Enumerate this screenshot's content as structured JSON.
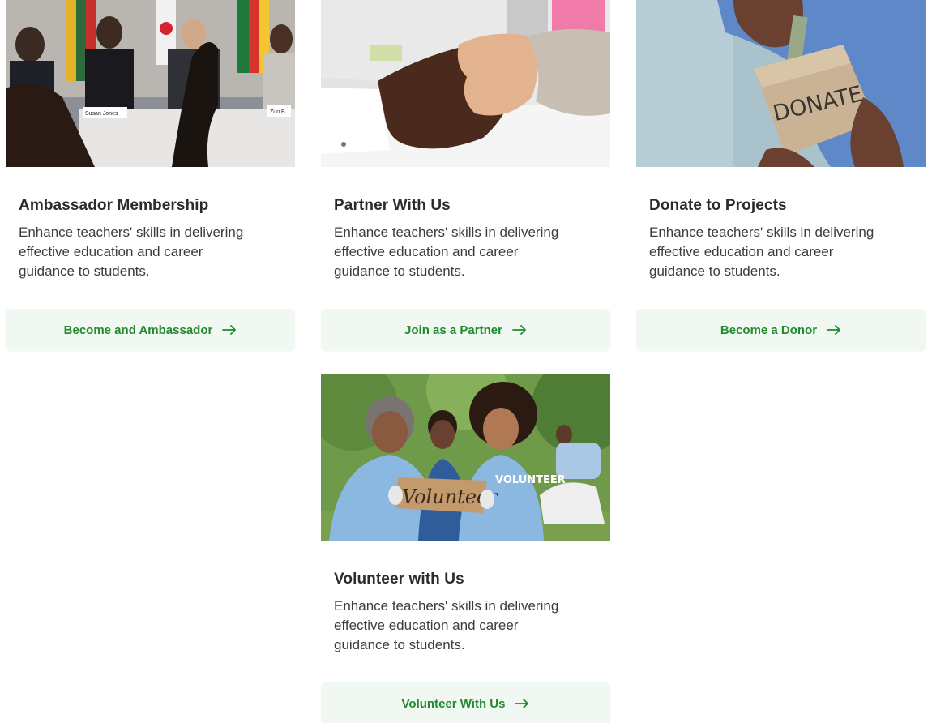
{
  "accent_color": "#1f8a2e",
  "button_bg": "#f1f8f1",
  "cards": [
    {
      "image": "conference-panel-photo",
      "title": "Ambassador Membership",
      "description": "Enhance teachers' skills in delivering effective education and career guidance to students.",
      "cta_label": "Become and Ambassador",
      "cta_icon": "arrow-right-icon",
      "photo_text": [
        "Susan Jones",
        "Zuri B"
      ]
    },
    {
      "image": "handshake-photo",
      "title": "Partner With Us",
      "description": "Enhance teachers' skills in delivering effective education and career guidance to students.",
      "cta_label": "Join as a Partner",
      "cta_icon": "arrow-right-icon"
    },
    {
      "image": "donate-box-photo",
      "title": "Donate to Projects",
      "description": "Enhance teachers' skills in delivering effective education and career guidance to students.",
      "cta_label": "Become a Donor",
      "cta_icon": "arrow-right-icon",
      "photo_text": [
        "DONATE"
      ]
    },
    {
      "image": "volunteers-photo",
      "title": "Volunteer with Us",
      "description": "Enhance teachers' skills in delivering effective education and career guidance to students.",
      "cta_label": "Volunteer With Us",
      "cta_icon": "arrow-right-icon",
      "photo_text": [
        "Volunteer",
        "VOLUNTEER"
      ]
    }
  ]
}
